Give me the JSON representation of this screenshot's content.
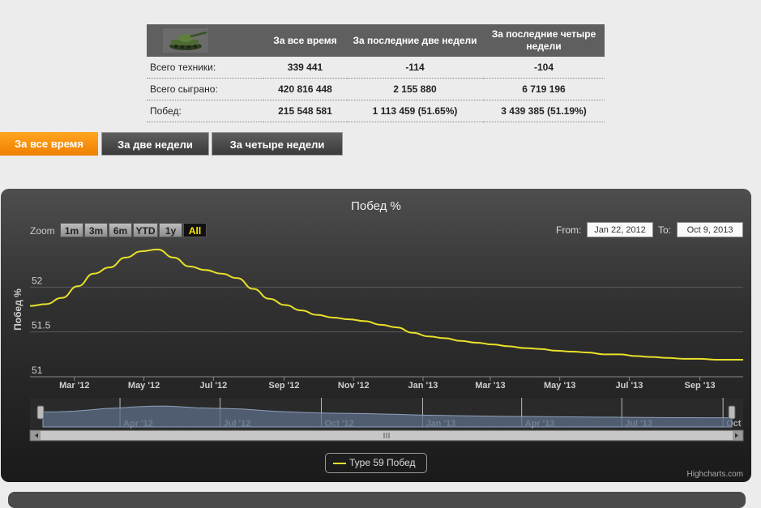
{
  "stats": {
    "headers": [
      "За все время",
      "За последние две недели",
      "За последние четыре недели"
    ],
    "rows": [
      {
        "label": "Всего техники:",
        "values": [
          "339 441",
          "-114",
          "-104"
        ]
      },
      {
        "label": "Всего сыграно:",
        "values": [
          "420 816 448",
          "2 155 880",
          "6 719 196"
        ]
      },
      {
        "label": "Побед:",
        "values": [
          "215 548 581",
          "1 113 459 (51.65%)",
          "3 439 385 (51.19%)"
        ]
      }
    ]
  },
  "tabs": [
    {
      "label": "За все время",
      "active": true
    },
    {
      "label": "За две недели",
      "active": false
    },
    {
      "label": "За четыре недели",
      "active": false
    }
  ],
  "chart_ui": {
    "zoom_label": "Zoom",
    "zoom_buttons": [
      "1m",
      "3m",
      "6m",
      "YTD",
      "1y",
      "All"
    ],
    "zoom_selected": "All",
    "from_label": "From:",
    "from_value": "Jan 22, 2012",
    "to_label": "To:",
    "to_value": "Oct 9, 2013",
    "credits": "Highcharts.com",
    "line_color": "#e8e02a",
    "accent_color": "#f59a10"
  },
  "chart_data": {
    "type": "line",
    "title": "Побед %",
    "ylabel": "Побед %",
    "xlabel": "",
    "ylim": [
      51,
      52.5
    ],
    "yticks": [
      "52",
      "51.5",
      "51"
    ],
    "x_range": [
      "2012-01-22",
      "2013-10-09"
    ],
    "xticks": [
      "Mar '12",
      "May '12",
      "Jul '12",
      "Sep '12",
      "Nov '12",
      "Jan '13",
      "Mar '13",
      "May '13",
      "Jul '13",
      "Sep '13"
    ],
    "navigator_ticks": [
      "Apr '12",
      "Jul '12",
      "Oct '12",
      "Jan '13",
      "Apr '13",
      "Jul '13",
      "Oct"
    ],
    "grid": true,
    "legend": "bottom-center",
    "series": [
      {
        "name": "Type 59 Побед",
        "x": [
          "2012-01-22",
          "2012-02-05",
          "2012-02-19",
          "2012-03-04",
          "2012-03-18",
          "2012-04-01",
          "2012-04-15",
          "2012-04-29",
          "2012-05-13",
          "2012-05-27",
          "2012-06-10",
          "2012-06-24",
          "2012-07-08",
          "2012-07-22",
          "2012-08-05",
          "2012-08-19",
          "2012-09-02",
          "2012-09-16",
          "2012-09-30",
          "2012-10-14",
          "2012-10-28",
          "2012-11-11",
          "2012-11-25",
          "2012-12-09",
          "2012-12-23",
          "2013-01-06",
          "2013-01-20",
          "2013-02-03",
          "2013-02-17",
          "2013-03-03",
          "2013-03-17",
          "2013-03-31",
          "2013-04-14",
          "2013-04-28",
          "2013-05-12",
          "2013-05-26",
          "2013-06-09",
          "2013-06-23",
          "2013-07-07",
          "2013-07-21",
          "2013-08-04",
          "2013-08-18",
          "2013-09-01",
          "2013-09-15",
          "2013-09-29",
          "2013-10-09"
        ],
        "values": [
          51.79,
          51.81,
          51.88,
          52.01,
          52.15,
          52.22,
          52.33,
          52.4,
          52.42,
          52.33,
          52.23,
          52.19,
          52.15,
          52.1,
          51.98,
          51.87,
          51.8,
          51.74,
          51.69,
          51.66,
          51.64,
          51.62,
          51.58,
          51.55,
          51.49,
          51.45,
          51.43,
          51.4,
          51.38,
          51.36,
          51.34,
          51.32,
          51.31,
          51.29,
          51.28,
          51.27,
          51.25,
          51.25,
          51.23,
          51.22,
          51.21,
          51.2,
          51.2,
          51.19,
          51.19,
          51.19
        ]
      }
    ]
  }
}
